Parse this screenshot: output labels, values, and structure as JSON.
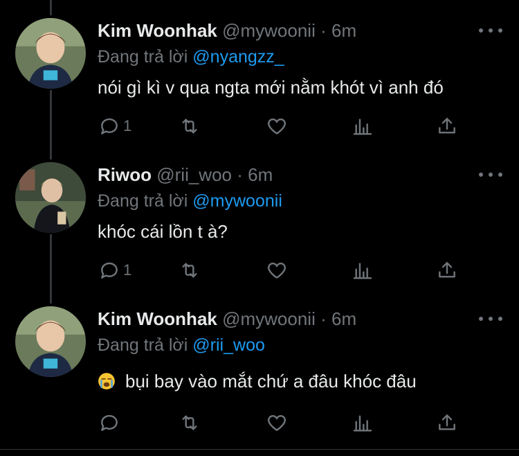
{
  "tweets": [
    {
      "name": "Kim Woonhak",
      "handle": "@mywoonii",
      "dot": "·",
      "time": "6m",
      "reply_prefix": "Đang trả lời",
      "reply_mention": "@nyangzz_",
      "text": "nói gì kì v qua ngta mới nằm khót vì anh đó",
      "reply_count": "1"
    },
    {
      "name": "Riwoo",
      "handle": "@rii_woo",
      "dot": "·",
      "time": "6m",
      "reply_prefix": "Đang trả lời",
      "reply_mention": "@mywoonii",
      "text": "khóc cái lồn t à?",
      "reply_count": "1"
    },
    {
      "name": "Kim Woonhak",
      "handle": "@mywoonii",
      "dot": "·",
      "time": "6m",
      "reply_prefix": "Đang trả lời",
      "reply_mention": "@rii_woo",
      "text": "bụi bay vào mắt chứ a đâu khóc đâu",
      "reply_count": ""
    }
  ],
  "colors": {
    "background": "#000000",
    "text": "#e7e9ea",
    "secondary": "#71767b",
    "accent": "#1d9bf0",
    "thread_line": "#333639"
  },
  "icons": [
    "reply-icon",
    "retweet-icon",
    "like-icon",
    "analytics-icon",
    "share-icon",
    "more-icon",
    "crying-face-emoji"
  ]
}
